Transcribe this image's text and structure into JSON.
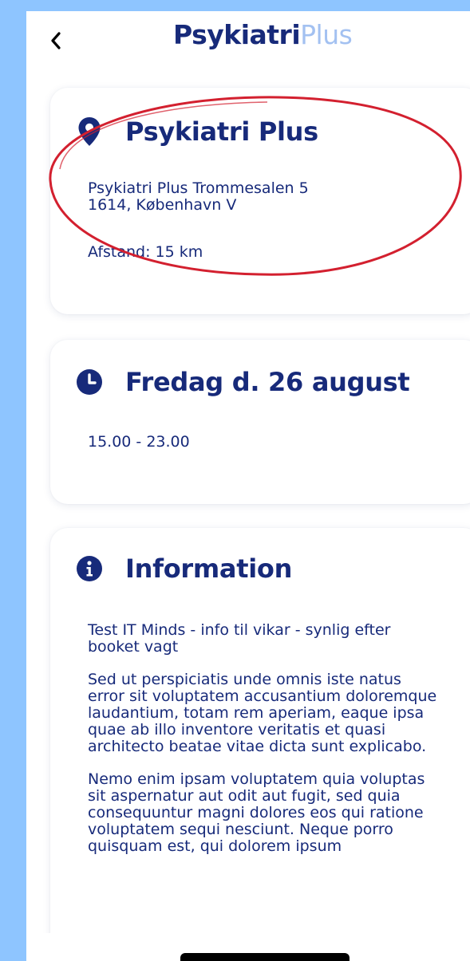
{
  "header": {
    "logo_part1": "Psykiatri",
    "logo_part2": "Plus"
  },
  "location_card": {
    "icon": "map-pin-icon",
    "title": "Psykiatri Plus",
    "address_line1": "Psykiatri Plus Trommesalen 5",
    "address_line2": "1614, København V",
    "distance": "Afstand: 15 km"
  },
  "date_card": {
    "icon": "clock-icon",
    "title": "Fredag d. 26 august",
    "time": "15.00 - 23.00"
  },
  "info_card": {
    "icon": "info-icon",
    "title": "Information",
    "paragraphs": [
      "Test IT Minds - info til vikar - synlig efter booket vagt",
      "Sed ut perspiciatis unde omnis iste natus error sit voluptatem accusantium doloremque laudantium, totam rem aperiam, eaque ipsa quae ab illo inventore veritatis et quasi architecto beatae vitae dicta sunt explicabo.",
      "Nemo enim ipsam voluptatem quia voluptas sit aspernatur aut odit aut fugit, sed quia consequuntur magni dolores eos qui ratione voluptatem sequi nesciunt. Neque porro quisquam est, qui dolorem ipsum"
    ]
  },
  "colors": {
    "brand_navy": "#172a7a",
    "brand_light": "#a3c1f1",
    "annotation_red": "#d3202f",
    "frame_background": "#8ec5ff"
  }
}
